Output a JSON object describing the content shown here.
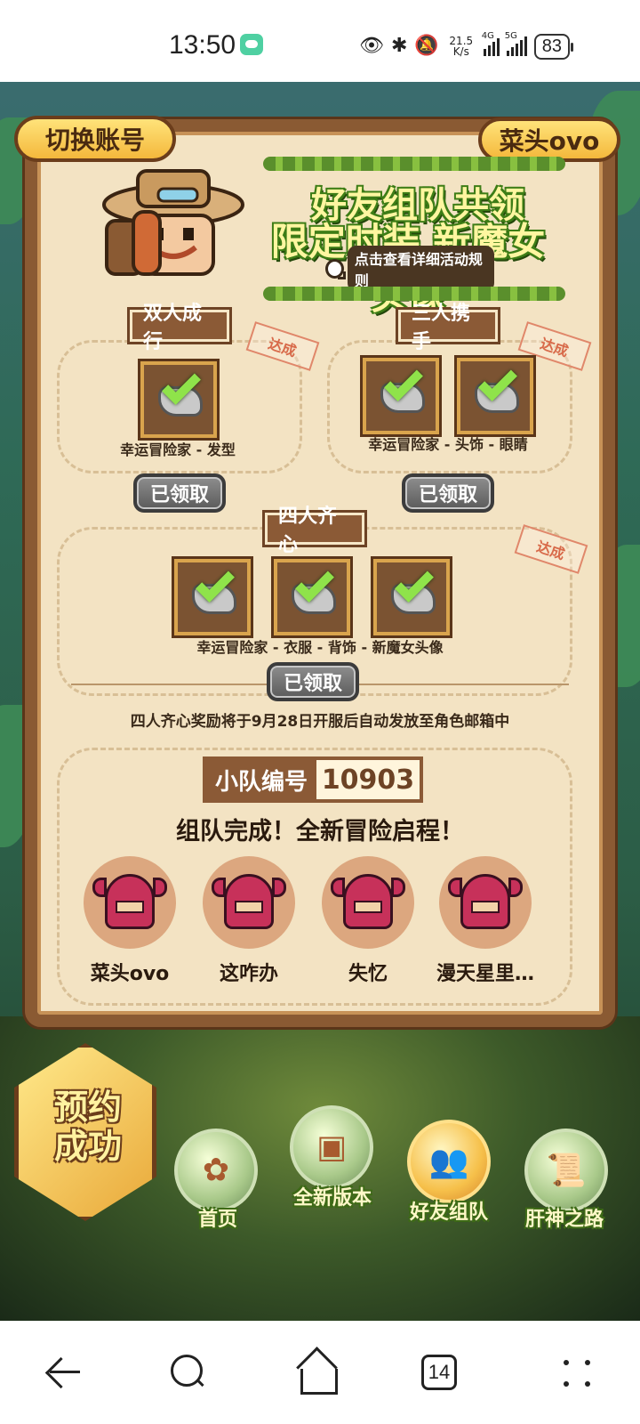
{
  "status_bar": {
    "time": "13:50",
    "net_speed_value": "21.5",
    "net_speed_unit": "K/s",
    "signal_1_label": "4G",
    "signal_2_label": "5G",
    "battery": "83"
  },
  "header": {
    "switch_account": "切换账号",
    "username": "菜头ovo"
  },
  "banner": {
    "line1": "好友组队共领",
    "line2": "限定时装 新魔女头像",
    "rules_link": "点击查看详细活动规则"
  },
  "rewards": {
    "duo": {
      "title": "双人成行",
      "stamp": "达成",
      "caption": "幸运冒险家 - 发型",
      "button": "已领取"
    },
    "trio": {
      "title": "三人携手",
      "stamp": "达成",
      "caption": "幸运冒险家 - 头饰 - 眼睛",
      "button": "已领取"
    },
    "quad": {
      "title": "四人齐心",
      "stamp": "达成",
      "caption": "幸运冒险家 - 衣服 - 背饰 - 新魔女头像",
      "button": "已领取"
    },
    "note": "四人齐心奖励将于9月28日开服后自动发放至角色邮箱中"
  },
  "team": {
    "id_label": "小队编号",
    "id_value": "10903",
    "status": "组队完成！全新冒险启程！",
    "members": [
      "菜头ovo",
      "这咋办",
      "失忆",
      "漫天星里…"
    ]
  },
  "bottom_menu": {
    "reserve_line1": "预约",
    "reserve_line2": "成功",
    "items": [
      {
        "label": "首页",
        "icon": "flower-icon"
      },
      {
        "label": "全新版本",
        "icon": "treasure-chest-icon"
      },
      {
        "label": "好友组队",
        "icon": "two-people-icon"
      },
      {
        "label": "肝神之路",
        "icon": "scroll-icon"
      }
    ],
    "active_index": 2
  },
  "system_nav": {
    "tab_count": "14"
  }
}
